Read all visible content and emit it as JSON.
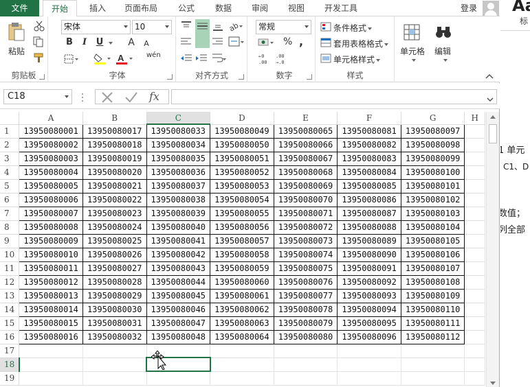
{
  "tabs": [
    {
      "id": "file",
      "label": "文件"
    },
    {
      "id": "home",
      "label": "开始"
    },
    {
      "id": "insert",
      "label": "插入"
    },
    {
      "id": "layout",
      "label": "页面布局"
    },
    {
      "id": "formula",
      "label": "公式"
    },
    {
      "id": "data",
      "label": "数据"
    },
    {
      "id": "review",
      "label": "审阅"
    },
    {
      "id": "view",
      "label": "视图"
    },
    {
      "id": "developer",
      "label": "开发工具"
    }
  ],
  "account": {
    "login_label": "登录"
  },
  "ribbon": {
    "clipboard": {
      "label": "剪贴板",
      "paste_label": "粘贴"
    },
    "font": {
      "label": "字体",
      "font_name": "宋体",
      "font_size": "10",
      "bold": "B",
      "italic": "I",
      "underline": "U",
      "grow": "A",
      "shrink": "A",
      "wen": "wén"
    },
    "alignment": {
      "label": "对齐方式"
    },
    "number": {
      "label": "数字",
      "format": "常规",
      "percent": "%",
      "comma": ","
    },
    "styles": {
      "label": "样式",
      "conditional": "条件格式",
      "table_format": "套用表格格式",
      "cell_styles": "单元格样式"
    },
    "cells": {
      "label": "单元格"
    },
    "editing": {
      "label": "编辑"
    }
  },
  "formula_bar": {
    "name_box": "C18",
    "fx": "fx",
    "value": ""
  },
  "grid": {
    "columns": [
      "A",
      "B",
      "C",
      "D",
      "E",
      "F",
      "G",
      "H"
    ],
    "selected_column": "C",
    "selected_row": 18,
    "row_count": 19,
    "rows": [
      [
        "13950080001",
        "13950080017",
        "13950080033",
        "13950080049",
        "13950080065",
        "13950080081",
        "13950080097"
      ],
      [
        "13950080002",
        "13950080018",
        "13950080034",
        "13950080050",
        "13950080066",
        "13950080082",
        "13950080098"
      ],
      [
        "13950080003",
        "13950080019",
        "13950080035",
        "13950080051",
        "13950080067",
        "13950080083",
        "13950080099"
      ],
      [
        "13950080004",
        "13950080020",
        "13950080036",
        "13950080052",
        "13950080068",
        "13950080084",
        "13950080100"
      ],
      [
        "13950080005",
        "13950080021",
        "13950080037",
        "13950080053",
        "13950080069",
        "13950080085",
        "13950080101"
      ],
      [
        "13950080006",
        "13950080022",
        "13950080038",
        "13950080054",
        "13950080070",
        "13950080086",
        "13950080102"
      ],
      [
        "13950080007",
        "13950080023",
        "13950080039",
        "13950080055",
        "13950080071",
        "13950080087",
        "13950080103"
      ],
      [
        "13950080008",
        "13950080024",
        "13950080040",
        "13950080056",
        "13950080072",
        "13950080088",
        "13950080104"
      ],
      [
        "13950080009",
        "13950080025",
        "13950080041",
        "13950080057",
        "13950080073",
        "13950080089",
        "13950080105"
      ],
      [
        "13950080010",
        "13950080026",
        "13950080042",
        "13950080058",
        "13950080074",
        "13950080090",
        "13950080106"
      ],
      [
        "13950080011",
        "13950080027",
        "13950080043",
        "13950080059",
        "13950080075",
        "13950080091",
        "13950080107"
      ],
      [
        "13950080012",
        "13950080028",
        "13950080044",
        "13950080060",
        "13950080076",
        "13950080092",
        "13950080108"
      ],
      [
        "13950080013",
        "13950080029",
        "13950080045",
        "13950080061",
        "13950080077",
        "13950080093",
        "13950080109"
      ],
      [
        "13950080014",
        "13950080030",
        "13950080046",
        "13950080062",
        "13950080078",
        "13950080094",
        "13950080110"
      ],
      [
        "13950080015",
        "13950080031",
        "13950080047",
        "13950080063",
        "13950080079",
        "13950080095",
        "13950080111"
      ],
      [
        "13950080016",
        "13950080032",
        "13950080048",
        "13950080064",
        "13950080080",
        "13950080096",
        "13950080112"
      ]
    ]
  },
  "side_doc": {
    "heading": "Aa",
    "sub": "标",
    "lines": [
      "1 单元",
      "C1、D",
      "数值；",
      "列全部"
    ]
  },
  "colors": {
    "excel_green": "#217346",
    "selection": "#217346"
  }
}
